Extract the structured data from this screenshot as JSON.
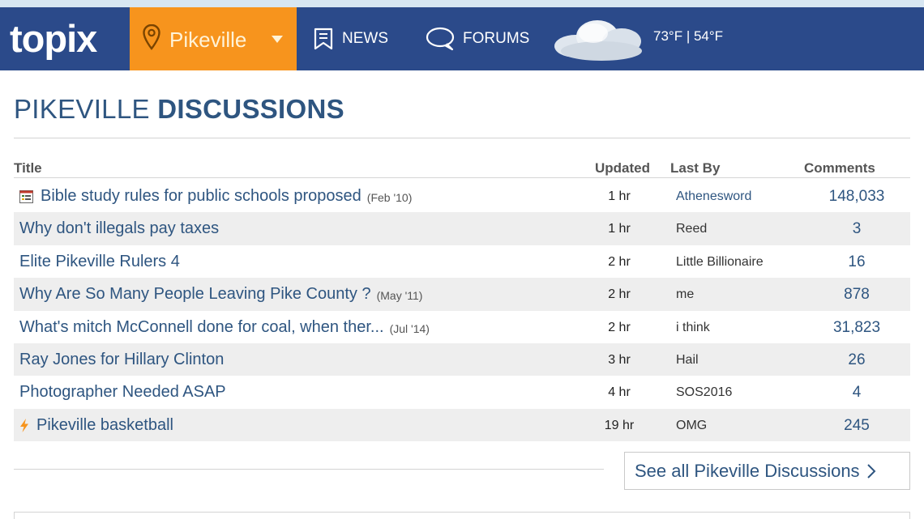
{
  "header": {
    "logo": "topix",
    "location": "Pikeville",
    "nav": [
      {
        "label": "NEWS",
        "icon": "bookmark-icon"
      },
      {
        "label": "FORUMS",
        "icon": "chat-bubble-icon"
      }
    ],
    "weather": {
      "icon": "cloud-icon",
      "temps": "73°F | 54°F"
    }
  },
  "colors": {
    "navbar": "#2b4a8a",
    "accent": "#f7941d",
    "link": "#2e5580",
    "row_alt": "#eeeeee"
  },
  "page": {
    "title_light": "PIKEVILLE",
    "title_bold": "DISCUSSIONS"
  },
  "table": {
    "headers": {
      "title": "Title",
      "updated": "Updated",
      "last_by": "Last By",
      "comments": "Comments"
    },
    "rows": [
      {
        "title": "Bible study rules for public schools proposed",
        "date": "(Feb '10)",
        "icon": "poll-icon",
        "updated": "1 hr",
        "last_by": "Athenesword",
        "comments": "148,033"
      },
      {
        "title": "Why don't illegals pay taxes",
        "date": "",
        "icon": "",
        "updated": "1 hr",
        "last_by": "Reed",
        "comments": "3"
      },
      {
        "title": "Elite Pikeville Rulers 4",
        "date": "",
        "icon": "",
        "updated": "2 hr",
        "last_by": "Little Billionaire",
        "comments": "16"
      },
      {
        "title": "Why Are So Many People Leaving Pike County ?",
        "date": "(May '11)",
        "icon": "",
        "updated": "2 hr",
        "last_by": "me",
        "comments": "878"
      },
      {
        "title": "What's mitch McConnell done for coal, when ther...",
        "date": "(Jul '14)",
        "icon": "",
        "updated": "2 hr",
        "last_by": "i think",
        "comments": "31,823"
      },
      {
        "title": "Ray Jones for Hillary Clinton",
        "date": "",
        "icon": "",
        "updated": "3 hr",
        "last_by": "Hail",
        "comments": "26"
      },
      {
        "title": "Photographer Needed ASAP",
        "date": "",
        "icon": "",
        "updated": "4 hr",
        "last_by": "SOS2016",
        "comments": "4"
      },
      {
        "title": "Pikeville basketball",
        "date": "",
        "icon": "lightning-icon",
        "updated": "19 hr",
        "last_by": "OMG",
        "comments": "245"
      }
    ]
  },
  "see_all": {
    "label": "See all Pikeville Discussions",
    "icon": "chevron-right-icon"
  }
}
